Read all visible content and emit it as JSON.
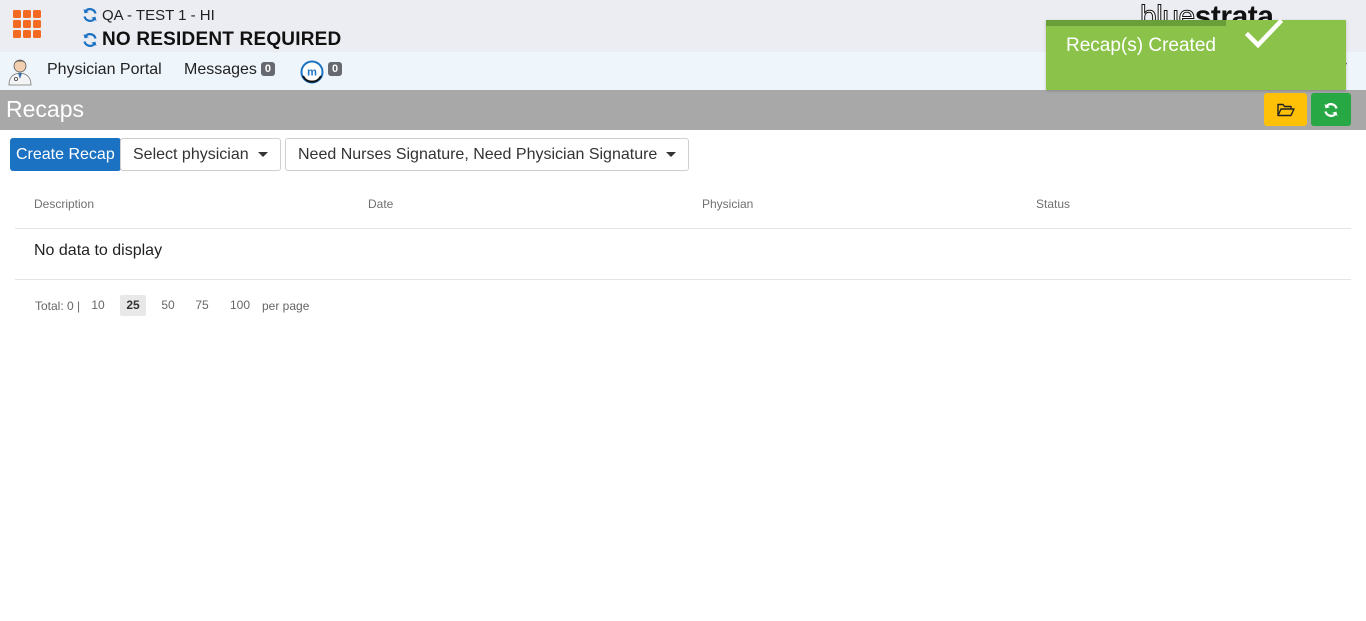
{
  "header": {
    "facility": "QA - TEST 1 - HI",
    "resident": "NO RESIDENT REQUIRED",
    "logo": {
      "dark": "strata",
      "light": "blue"
    }
  },
  "nav": {
    "portal_label": "Physician Portal",
    "messages_label": "Messages",
    "messages_count": "0",
    "m_count": "0"
  },
  "title_bar": {
    "title": "Recaps"
  },
  "toast": {
    "message": "Recap(s) Created"
  },
  "toolbar": {
    "create_label": "Create Recap",
    "physician_select": "Select physician",
    "status_filter": "Need Nurses Signature, Need Physician Signature"
  },
  "table": {
    "columns": [
      "Description",
      "Date",
      "Physician",
      "Status"
    ],
    "empty_message": "No data to display"
  },
  "pager": {
    "total": "Total: 0 |",
    "sizes": [
      "10",
      "25",
      "50",
      "75",
      "100"
    ],
    "selected": "25",
    "suffix": "per page"
  },
  "colors": {
    "accent_orange": "#f26a22",
    "primary_blue": "#1b72c2",
    "toast_green": "#8bc34a",
    "refresh_green": "#28a745",
    "folder_yellow": "#ffc107"
  }
}
